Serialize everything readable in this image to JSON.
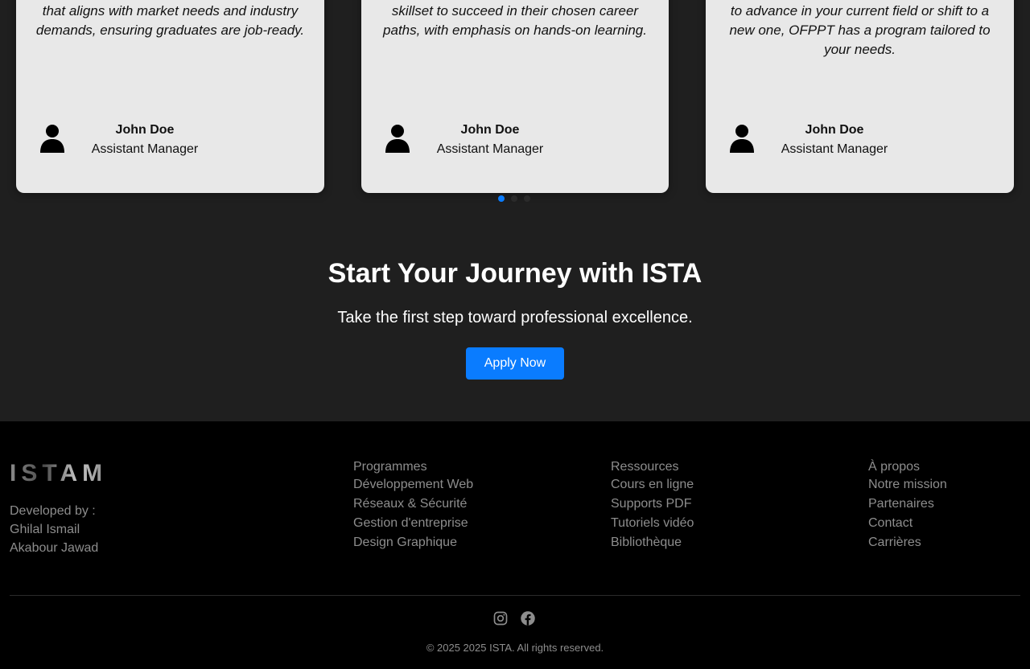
{
  "testimonials": {
    "cards": [
      {
        "quote": "focuses on providing practical knowledge that aligns with market needs and industry demands, ensuring graduates are job-ready.",
        "name": "John Doe",
        "role": "Assistant Manager"
      },
      {
        "quote": "are designed to provide individuals with the skillset to succeed in their chosen career paths, with emphasis on hands-on learning.",
        "name": "John Doe",
        "role": "Assistant Manager"
      },
      {
        "quote": "professional success. Whether you're looking to advance in your current field or shift to a new one, OFPPT has a program tailored to your needs.",
        "name": "John Doe",
        "role": "Assistant Manager"
      }
    ],
    "active_dot": 1,
    "dot_count": 3
  },
  "cta": {
    "title": "Start Your Journey with ISTA",
    "subtitle": "Take the first step toward professional excellence.",
    "button_label": "Apply Now"
  },
  "footer": {
    "brand": "ISTAM",
    "developed_by_label": "Developed by :",
    "developers": [
      "Ghilal Ismail",
      "Akabour Jawad"
    ],
    "columns": [
      {
        "title": "Programmes",
        "links": [
          "Développement Web",
          "Réseaux & Sécurité",
          "Gestion d'entreprise",
          "Design Graphique"
        ]
      },
      {
        "title": "Ressources",
        "links": [
          "Cours en ligne",
          "Supports PDF",
          "Tutoriels vidéo",
          "Bibliothèque"
        ]
      },
      {
        "title": "À propos",
        "links": [
          "Notre mission",
          "Partenaires",
          "Contact",
          "Carrières"
        ]
      }
    ],
    "socials": [
      "instagram-icon",
      "facebook-icon"
    ],
    "copyright": "© 2025 2025 ISTA. All rights reserved."
  },
  "colors": {
    "accent": "#0a7cff",
    "cta_bg": "#1f1f1f",
    "footer_bg": "#000000",
    "card_bg": "#e8e8e8",
    "footer_text": "#8d8d8d"
  }
}
